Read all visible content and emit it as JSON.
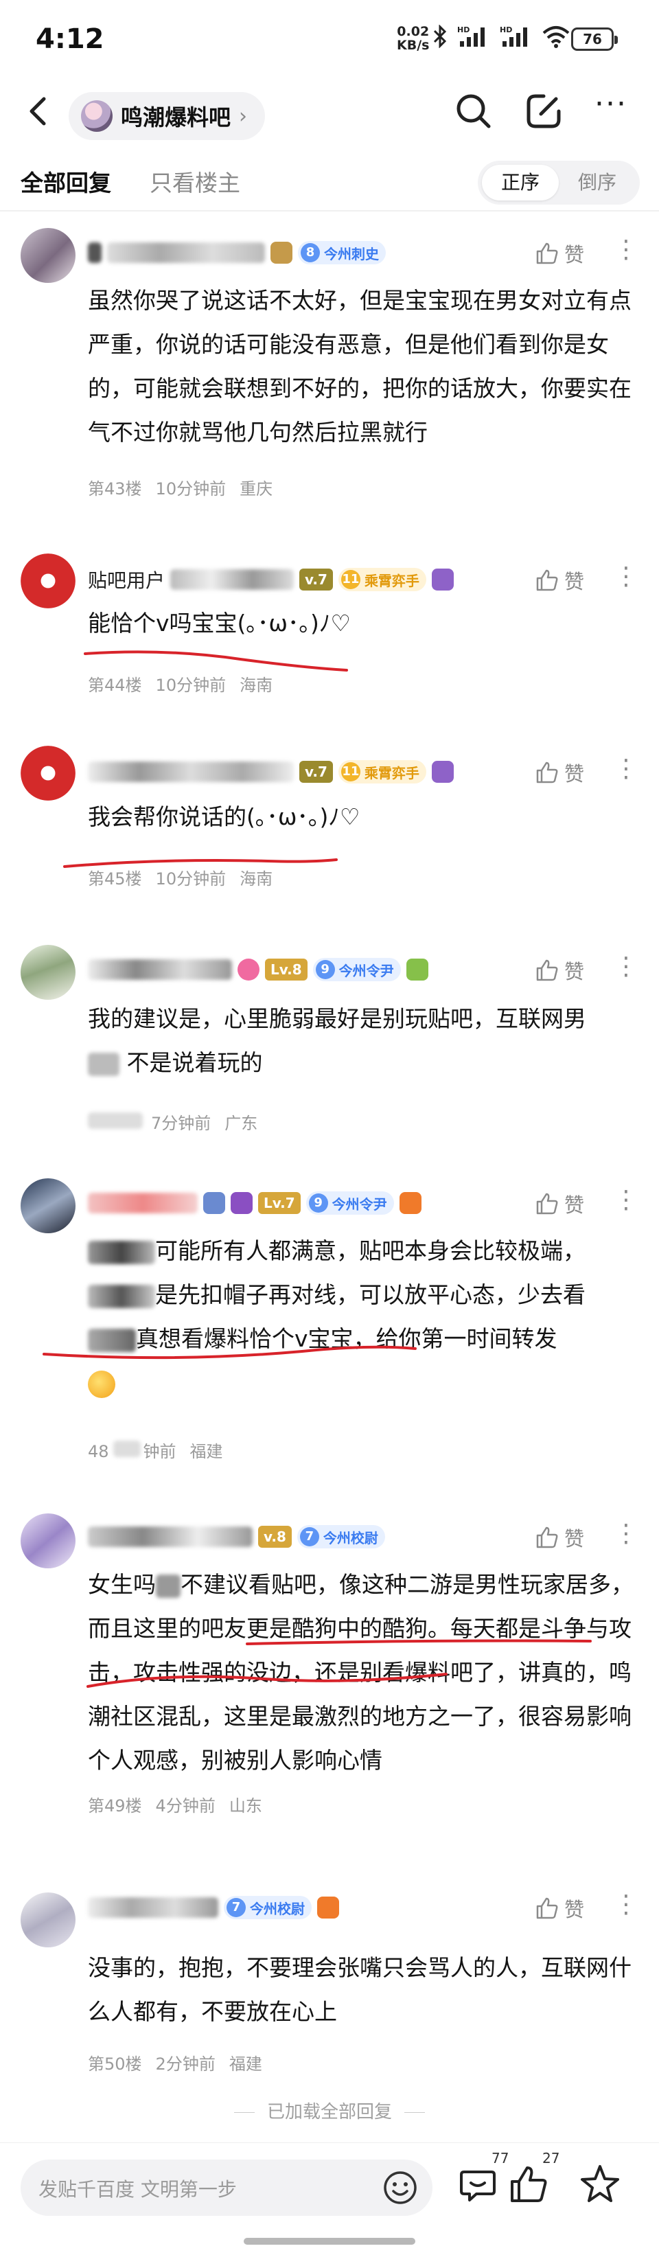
{
  "status_bar": {
    "time": "4:12",
    "net_speed": "0.02",
    "net_unit": "KB/s",
    "battery": "76"
  },
  "nav": {
    "forum_name": "鸣潮爆料吧",
    "chevron": "›",
    "icons": [
      "back-icon",
      "search-icon",
      "edit-icon",
      "more-icon"
    ]
  },
  "tabs": {
    "all_replies": "全部回复",
    "only_op": "只看楼主",
    "order_asc": "正序",
    "order_desc": "倒序"
  },
  "like_label": "赞",
  "posts": [
    {
      "badge_num": "8",
      "badge_text": "今州刺史",
      "content": "虽然你哭了说这话不太好，但是宝宝现在男女对立有点严重，你说的话可能没有恶意，但是他们看到你是女的，可能就会联想到不好的，把你的话放大，你要实在气不过你就骂他几句然后拉黑就行",
      "floor": "第43楼",
      "time": "10分钟前",
      "location": "重庆"
    },
    {
      "username": "贴吧用户",
      "level": "v.7",
      "badge_num": "11",
      "badge_text": "乘霄弈手",
      "content": "能恰个v吗宝宝(｡･ω･｡)ﾉ♡",
      "floor": "第44楼",
      "time": "10分钟前",
      "location": "海南"
    },
    {
      "level": "v.7",
      "badge_num": "11",
      "badge_text": "乘霄弈手",
      "content": "我会帮你说话的(｡･ω･｡)ﾉ♡",
      "floor": "第45楼",
      "time": "10分钟前",
      "location": "海南"
    },
    {
      "level": "Lv.8",
      "badge_num": "9",
      "badge_text": "今州令尹",
      "content_lines": [
        "我的建议是，心里脆弱最好是别玩贴吧，互联网男",
        "不是说着玩的"
      ],
      "time": "7分钟前",
      "location": "广东"
    },
    {
      "level": "Lv.7",
      "badge_num": "9",
      "badge_text": "今州令尹",
      "content_lines": [
        "可能所有人都满意，贴吧本身会比较极端，",
        "是先扣帽子再对线，可以放平心态，少去看",
        "真想看爆料恰个v宝宝，给你第一时间转发"
      ],
      "floor_prefix": "48",
      "time": "钟前",
      "location": "福建"
    },
    {
      "level": "v.8",
      "badge_num": "7",
      "badge_text": "今州校尉",
      "content_lines": [
        "女生吗",
        "不建议看贴吧，像这种二游是男性玩家居多，而且这里的吧友更是酷狗中的酷狗。每天都是斗争与攻击，攻击性强的没边，还是别看爆料吧了，讲真的，鸣潮社区混乱，这里是最激烈的地方之一了，很容易影响个人观感，别被别人影响心情"
      ],
      "floor_prefix": "第49楼",
      "time": "4分钟前",
      "location": "山东"
    },
    {
      "badge_num": "7",
      "badge_text": "今州校尉",
      "content": "没事的，抱抱，不要理会张嘴只会骂人的人，互联网什么人都有，不要放在心上",
      "floor": "第50楼",
      "time": "2分钟前",
      "location": "福建"
    }
  ],
  "footer": {
    "loaded_text": "已加载全部回复",
    "input_placeholder": "发贴千百度 文明第一步",
    "comment_count": "77",
    "like_count": "27"
  }
}
